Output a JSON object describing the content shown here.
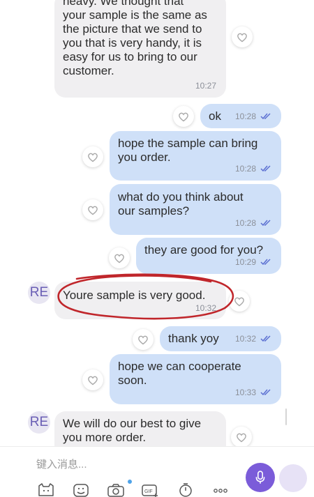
{
  "messages": [
    {
      "direction": "in",
      "text": "heavy. We thought that\nyour sample is the same as\nthe picture that we send to\nyou that is very handy, it is\neasy for us to bring to our\ncustomer.",
      "time": "10:27"
    },
    {
      "direction": "out",
      "text": "ok",
      "time": "10:28"
    },
    {
      "direction": "out",
      "text": "hope the sample can bring\nyou order.",
      "time": "10:28"
    },
    {
      "direction": "out",
      "text": "what do you think about\nour samples?",
      "time": "10:28"
    },
    {
      "direction": "out",
      "text": "they are good for you?",
      "time": "10:29"
    },
    {
      "direction": "in",
      "avatar": "RE",
      "text": "Youre sample is very good.",
      "time": "10:32"
    },
    {
      "direction": "out",
      "text": "thank yoy",
      "time": "10:32"
    },
    {
      "direction": "out",
      "text": "hope we can cooperate\nsoon.",
      "time": "10:33"
    },
    {
      "direction": "in",
      "avatar": "RE",
      "text": "We will do our best to give\nyou more order.",
      "time": ""
    }
  ],
  "composer": {
    "placeholder": "键入消息...",
    "icons": [
      "sticker-icon",
      "emoji-icon",
      "camera-icon",
      "gif-icon",
      "timer-icon",
      "more-icon"
    ],
    "mic_icon": "microphone-icon"
  },
  "colors": {
    "incoming_bubble": "#f0eff1",
    "outgoing_bubble": "#cfe0f8",
    "accent": "#7b5cd9",
    "annotation": "#c0262b"
  }
}
